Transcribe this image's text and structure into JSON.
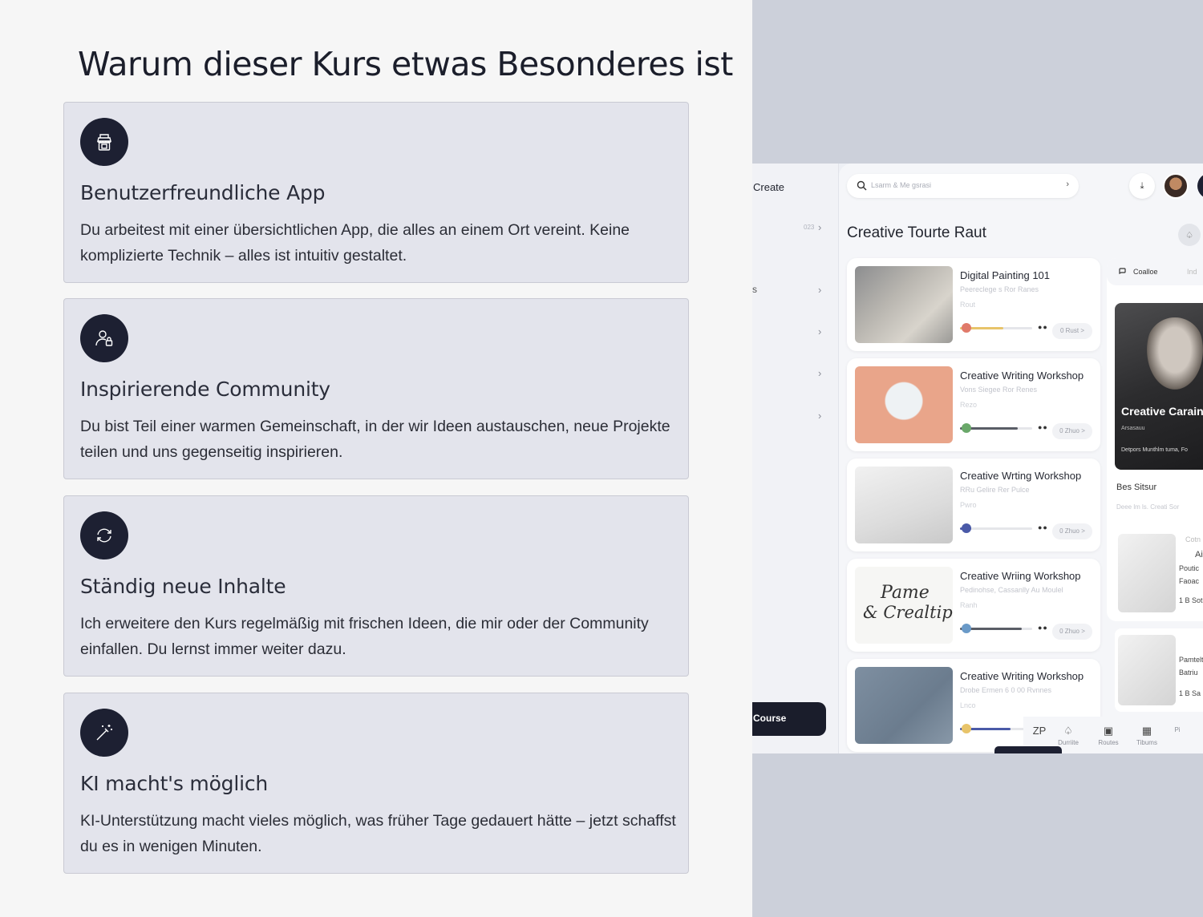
{
  "page_title": "Warum dieser Kurs etwas Besonderes ist",
  "features": [
    {
      "title": "Benutzerfreundliche App",
      "text": "Du arbeitest mit einer übersichtlichen App, die alles an einem Ort vereint. Keine komplizierte Technik – alles ist intuitiv gestaltet.",
      "icon": "shop-icon"
    },
    {
      "title": "Inspirierende Community",
      "text": "Du bist Teil einer warmen Gemeinschaft, in der wir Ideen austauschen, neue Projekte teilen und uns gegenseitig inspirieren.",
      "icon": "user-lock-icon"
    },
    {
      "title": "Ständig neue Inhalte",
      "text": "Ich erweitere den Kurs regelmäßig mit frischen Ideen, die mir oder der Community einfallen. Du lernst immer weiter dazu.",
      "icon": "refresh-icon"
    },
    {
      "title": "KI macht's möglich",
      "text": "KI-Unterstützung macht vieles möglich, was früher Tage gedauert hätte – jetzt schaffst du es in wenigen Minuten.",
      "icon": "magic-wand-icon"
    }
  ],
  "mockup": {
    "sidebar": {
      "create_label": "Create",
      "count": "023",
      "s_letter": "s",
      "course_button": "Course"
    },
    "search": {
      "placeholder": "Lsarm & Me gsrasi"
    },
    "main_title": "Creative Tourte Raut",
    "courses": [
      {
        "title": "Digital Painting 101",
        "sub": "Peereclege s Ror Ranes",
        "sub2": "Rout",
        "pill": "0 Rust >",
        "progress": 0.6,
        "bar_color": "#e8c46a",
        "dot_color": "#e07a6a"
      },
      {
        "title": "Creative Writing Workshop",
        "sub": "Vons Siegee Ror Renes",
        "sub2": "Rezo",
        "pill": "0 Zhuo >",
        "progress": 0.8,
        "bar_color": "#5a5d66",
        "dot_color": "#6aa86a"
      },
      {
        "title": "Creative Wrting Workshop",
        "sub": "RRu Gelire Rer Pulce",
        "sub2": "Pwro",
        "pill": "0 Zhuo >",
        "progress": 0.15,
        "bar_color": "#4a5aa8",
        "dot_color": "#4a5aa8"
      },
      {
        "title": "Creative Wriing Workshop",
        "sub": "Pedinohse, Cassanlly Au Moulel",
        "sub2": "Ranh",
        "pill": "0 Zhuo >",
        "progress": 0.85,
        "bar_color": "#5a5d66",
        "dot_color": "#6a9ac8"
      },
      {
        "title": "Creative Writing Workshop",
        "sub": "Drobe Ermen 6 0 00 Rvnnes",
        "sub2": "Lnco",
        "pill": "",
        "progress": 0.7,
        "bar_color": "#4a5aa8",
        "dot_color": "#e8c46a"
      }
    ],
    "handwriting": {
      "line1": "Pame",
      "line2": "& Crealtip"
    },
    "right_panel": {
      "tab": "Coalloe",
      "tab2": "Ind",
      "hero_title": "Creative Carain",
      "hero_sub": "Arsasauu",
      "hero_sub2": "Detpors Munthlm tuma, Fo",
      "label": "Bes Sitsur",
      "sub": "Deee lm ls. Creati Sor",
      "mini1": [
        "Cotn",
        "Ai",
        "Poutic",
        "Faoac",
        "1 B Sot"
      ],
      "mini2": [
        "Pamtelt",
        "Batriu",
        "1 B Sa"
      ]
    },
    "bottom_nav": [
      {
        "icon": "ZP",
        "label": ""
      },
      {
        "icon": "♤",
        "label": "Durriite"
      },
      {
        "icon": "▣",
        "label": "Routes"
      },
      {
        "icon": "▦",
        "label": "Tibums"
      },
      {
        "icon": "",
        "label": "Pi"
      }
    ]
  },
  "colors": {
    "icon_circle": "#1d2032",
    "card_bg": "#e3e4ec",
    "mockup_bg": "#ccd0da"
  }
}
